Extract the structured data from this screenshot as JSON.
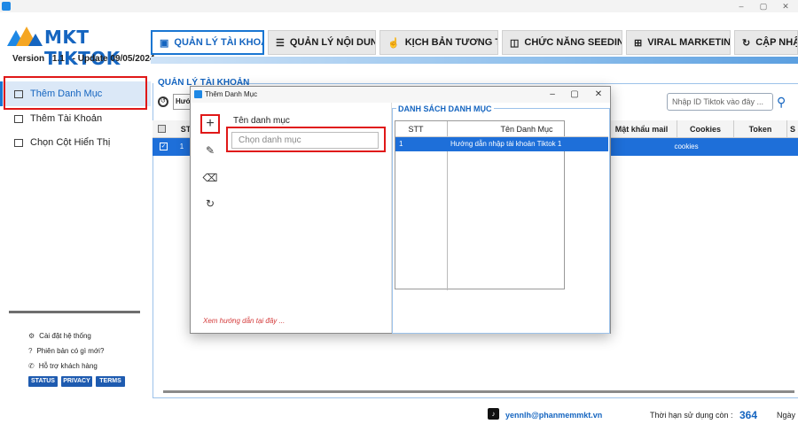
{
  "window": {
    "minimize": "–",
    "maximize": "▢",
    "close": "✕"
  },
  "brand": {
    "name": "MKT TIKTOK",
    "version_label": "Version",
    "version": "1.1",
    "update": "- Update  09/05/2024"
  },
  "nav": {
    "tabs": [
      {
        "label": "QUẢN LÝ TÀI KHOẢN",
        "icon": "account-box-icon"
      },
      {
        "label": "QUẢN LÝ NỘI DUNG",
        "icon": "list-icon"
      },
      {
        "label": "KỊCH BẢN TƯƠNG TÁC",
        "icon": "hand-icon"
      },
      {
        "label": "CHỨC NĂNG SEEDING",
        "icon": "seeding-icon"
      },
      {
        "label": "VIRAL MARKETING",
        "icon": "grid-icon"
      },
      {
        "label": "CẬP NHẬ",
        "icon": "update-icon"
      }
    ]
  },
  "sidebar": {
    "items": [
      {
        "label": "Thêm Danh Mục",
        "icon": "folder-icon"
      },
      {
        "label": "Thêm Tài Khoản",
        "icon": "copy-icon"
      },
      {
        "label": "Chọn Cột Hiển Thị",
        "icon": "monitor-icon"
      }
    ],
    "links": [
      {
        "label": "Cài đặt hệ thống",
        "icon": "gear-icon"
      },
      {
        "label": "Phiên bản có gì mới?",
        "icon": "help-icon"
      },
      {
        "label": "Hỗ trợ khách hàng",
        "icon": "support-icon"
      }
    ],
    "pills": [
      "STATUS",
      "PRIVACY",
      "TERMS"
    ]
  },
  "main": {
    "section_title": "QUẢN LÝ TÀI KHOẢN",
    "category_combo": "Hướ",
    "search_placeholder": "Nhập ID Tiktok vào đây ...",
    "table": {
      "headers": [
        "ST",
        "Mật khẩu mail",
        "Cookies",
        "Token",
        "S"
      ],
      "row": {
        "stt": "1",
        "cookies": "cookies"
      }
    }
  },
  "dialog": {
    "title": "Thêm Danh Mục",
    "field_label": "Tên danh mục",
    "field_placeholder": "Chọn danh mục",
    "guide_link": "Xem hướng dẫn tại đây ...",
    "list_title": "DANH SÁCH DANH MỤC",
    "grid_headers": [
      "STT",
      "Tên Danh Mục"
    ],
    "grid_rows": [
      {
        "stt": "1",
        "name": "Hướng dẫn nhập tài khoản Tiktok 1"
      }
    ]
  },
  "footer": {
    "email": "yennlh@phanmemmkt.vn",
    "remaining_label": "Thời hạn sử dụng còn :",
    "days": "364",
    "unit": "Ngày"
  },
  "colors": {
    "accent": "#1565c0",
    "highlight": "#1e6fd9",
    "annotation": "#e01818"
  }
}
